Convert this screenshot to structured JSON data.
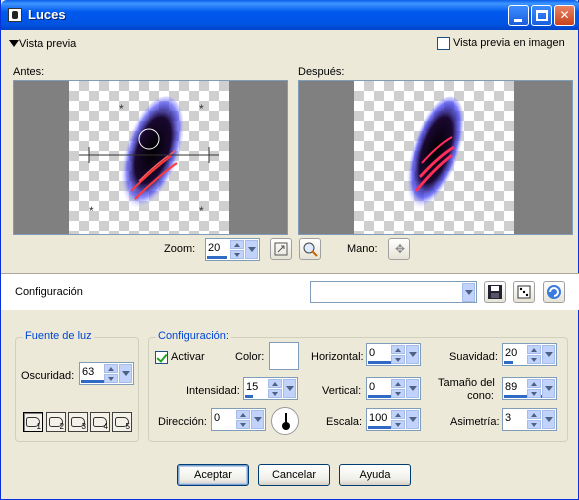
{
  "window": {
    "title": "Luces"
  },
  "preview": {
    "toggle_label": "Vista previa",
    "image_preview_label": "Vista previa en imagen",
    "image_preview_checked": false,
    "before_label": "Antes:",
    "after_label": "Después:",
    "zoom_label": "Zoom:",
    "zoom_value": "20",
    "hand_label": "Mano:"
  },
  "preset": {
    "label": "Configuración",
    "value": ""
  },
  "light_source": {
    "group_title": "Fuente de luz",
    "darkness_label": "Oscuridad:",
    "darkness_value": "63",
    "lights": [
      "1",
      "2",
      "3",
      "4",
      "5"
    ]
  },
  "settings": {
    "group_title": "Configuración:",
    "activate_label": "Activar",
    "activate_checked": true,
    "color_label": "Color:",
    "color_value": "#FFFFFF",
    "intensity_label": "Intensidad:",
    "intensity_value": "15",
    "direction_label": "Dirección:",
    "direction_value": "0",
    "horizontal_label": "Horizontal:",
    "horizontal_value": "0",
    "vertical_label": "Vertical:",
    "vertical_value": "0",
    "scale_label": "Escala:",
    "scale_value": "100",
    "smoothness_label": "Suavidad:",
    "smoothness_value": "20",
    "cone_size_label_line1": "Tamaño del",
    "cone_size_label_line2": "cono:",
    "cone_size_value": "89",
    "asymmetry_label": "Asimetría:",
    "asymmetry_value": "3"
  },
  "buttons": {
    "ok": "Aceptar",
    "cancel": "Cancelar",
    "help": "Ayuda"
  }
}
